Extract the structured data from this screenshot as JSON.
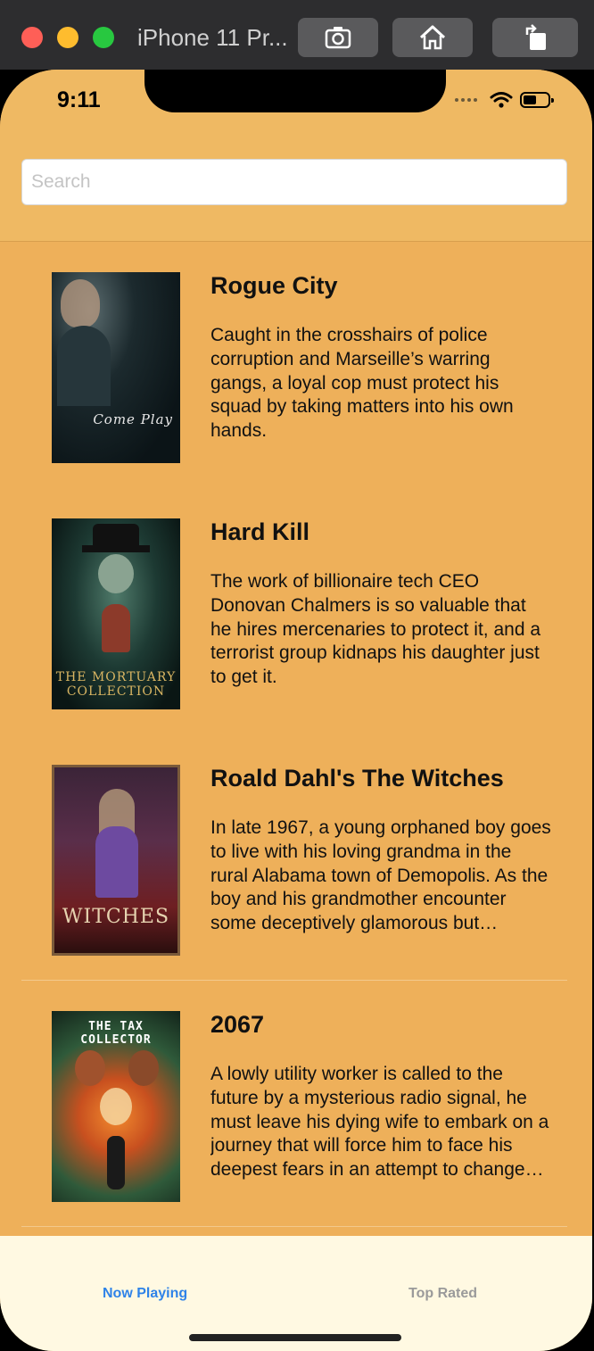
{
  "window": {
    "title": "iPhone 11 Pr..."
  },
  "status_bar": {
    "time": "9:11"
  },
  "search": {
    "placeholder": "Search"
  },
  "movies": [
    {
      "title": "Rogue City",
      "overview": "Caught in the crosshairs of police corruption and Marseille’s warring gangs, a loyal cop must protect his squad by taking matters into his own hands.",
      "poster_text": "Come Play"
    },
    {
      "title": "Hard Kill",
      "overview": "The work of billionaire tech CEO Donovan Chalmers is so valuable that he hires mercenaries to protect it, and a terrorist group kidnaps his daughter just to get it.",
      "poster_text": "THE MORTUARY COLLECTION"
    },
    {
      "title": "Roald Dahl's The Witches",
      "overview": "In late 1967, a young orphaned boy goes to live with his loving grandma in the rural Alabama town of Demopolis. As the boy and his grandmother encounter some deceptively glamorous but thoroughly diabolical witches",
      "poster_text": "WITCHES"
    },
    {
      "title": "2067",
      "overview": "A lowly utility worker is called to the future by a mysterious radio signal, he must leave his dying wife to embark on a journey that will force him to face his deepest fears in an attempt to change the past",
      "poster_text": "THE TAX COLLECTOR"
    }
  ],
  "tabs": {
    "now_playing": "Now Playing",
    "top_rated": "Top Rated"
  },
  "colors": {
    "background": "#eeb05a",
    "header": "#efb963",
    "tab_bar": "#fff9e2",
    "active_tab": "#2f83e8",
    "inactive_tab": "#9a9a9a"
  }
}
